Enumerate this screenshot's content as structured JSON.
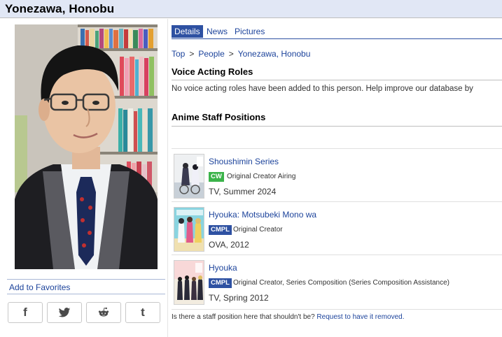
{
  "person": {
    "name": "Yonezawa, Honobu"
  },
  "sidebar": {
    "add_to_favorites": "Add to Favorites",
    "share": [
      {
        "icon": "facebook-icon",
        "glyph": "f"
      },
      {
        "icon": "twitter-icon"
      },
      {
        "icon": "reddit-icon"
      },
      {
        "icon": "tumblr-icon",
        "glyph": "t"
      }
    ]
  },
  "tabs": [
    {
      "label": "Details",
      "active": true
    },
    {
      "label": "News",
      "active": false
    },
    {
      "label": "Pictures",
      "active": false
    }
  ],
  "breadcrumb": {
    "items": [
      "Top",
      "People",
      "Yonezawa, Honobu"
    ],
    "separator": ">"
  },
  "voice_acting": {
    "heading": "Voice Acting Roles",
    "empty_text": "No voice acting roles have been added to this person. Help improve our database by"
  },
  "staff": {
    "heading": "Anime Staff Positions",
    "entries": [
      {
        "title": "Shoushimin Series",
        "badge": "CW",
        "badge_color": "#3bb34a",
        "role": "Original Creator Airing",
        "season": "TV, Summer 2024"
      },
      {
        "title": "Hyouka: Motsubeki Mono wa",
        "badge": "CMPL",
        "badge_color": "#2e51a2",
        "role": "Original Creator",
        "season": "OVA, 2012"
      },
      {
        "title": "Hyouka",
        "badge": "CMPL",
        "badge_color": "#2e51a2",
        "role": "Original Creator, Series Composition (Series Composition Assistance)",
        "season": "TV, Spring 2012"
      }
    ],
    "footer_text": "Is there a staff position here that shouldn't be?",
    "footer_link": "Request to have it removed."
  },
  "colors": {
    "header_bg": "#e1e7f5",
    "link": "#1c439b",
    "tab_active": "#2e51a2"
  }
}
